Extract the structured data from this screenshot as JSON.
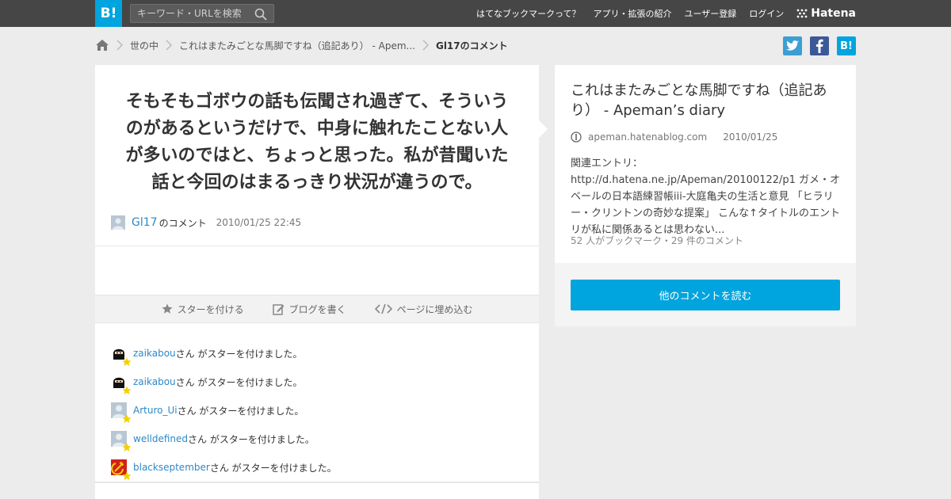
{
  "topbar": {
    "logo": "B!",
    "search_placeholder": "キーワード・URLを検索",
    "nav": [
      "はてなブックマークって？",
      "アプリ・拡張の紹介",
      "ユーザー登録",
      "ログイン"
    ],
    "brand": "Hatena"
  },
  "breadcrumb": {
    "items": [
      "世の中",
      "これはまたみごとな馬脚ですね（追記あり） - Apem..."
    ],
    "current": "Gl17のコメント"
  },
  "share": {
    "twitter_color": "#3b9fd5",
    "facebook_color": "#3b5998",
    "hatena_label": "B!",
    "hatena_color": "#00a4de"
  },
  "comment": {
    "text": "そもそもゴボウの話も伝聞され過ぎて、そういうのがあるというだけで、中身に触れたことない人が多いのではと、ちょっと思った。私が昔聞いた話と今回のはまるっきり状況が違うので。",
    "user": "Gl17",
    "suffix": "のコメント",
    "time": "2010/01/25 22:45"
  },
  "actions": {
    "star": "スターを付ける",
    "blog": "ブログを書く",
    "embed": "ページに埋め込む"
  },
  "stars": {
    "suffix": "さん がスターを付けました。",
    "users": [
      "zaikabou",
      "zaikabou",
      "Arturo_Ui",
      "welldefined",
      "blackseptember"
    ]
  },
  "entry": {
    "title": "これはまたみごとな馬脚ですね（追記あり） - Apeman’s diary",
    "domain": "apeman.hatenablog.com",
    "date": "2010/01/25",
    "excerpt": "関連エントリ：http://d.hatena.ne.jp/Apeman/20100122/p1 ガメ・オベールの日本語練習帳iii-大庭亀夫の生活と意見 「ヒラリー・クリントンの奇妙な提案」 こんな↑タイトルのエントリが私に関係あるとは思わない...",
    "counts": "52 人がブックマーク・29 件のコメント",
    "read_more": "他のコメントを読む"
  },
  "colors": {
    "accent": "#00a4de",
    "link": "#2d88c8",
    "topbar": "#464646"
  }
}
